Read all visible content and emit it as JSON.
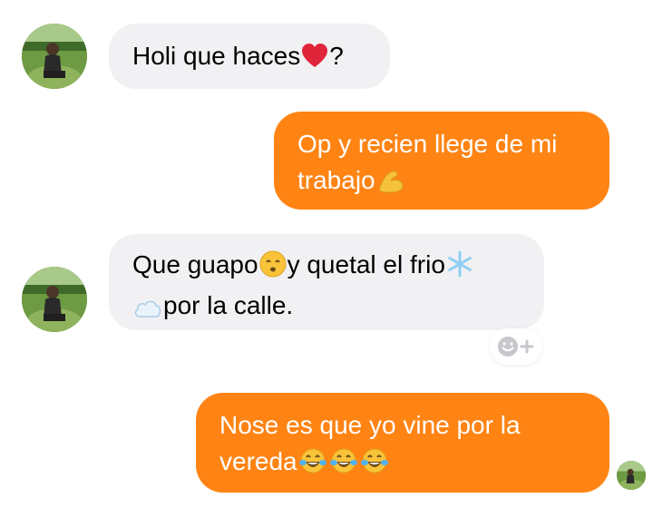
{
  "conversation": {
    "messages": [
      {
        "direction": "incoming",
        "lines": [
          [
            "Holi que haces",
            "heart-emoji",
            "?"
          ]
        ]
      },
      {
        "direction": "outgoing",
        "lines": [
          [
            "Op y recien llege de mi"
          ],
          [
            "trabajo",
            "flexed-biceps-emoji"
          ]
        ]
      },
      {
        "direction": "incoming",
        "lines": [
          [
            "Que guapo",
            "kissing-emoji",
            "y quetal el frio",
            "snowflake-emoji"
          ],
          [
            "cloud-emoji",
            "por la calle."
          ]
        ]
      },
      {
        "direction": "outgoing",
        "lines": [
          [
            "Nose es que yo vine por la"
          ],
          [
            "vereda",
            "tears-of-joy-emoji",
            "tears-of-joy-emoji",
            "tears-of-joy-emoji"
          ]
        ]
      }
    ],
    "m1": {
      "text1": "Holi que haces",
      "text2": "?"
    },
    "m2": {
      "line1": "Op y recien llege de mi",
      "line2": "trabajo"
    },
    "m3": {
      "line1a": "Que guapo",
      "line1b": "y quetal el frio",
      "line2": "por la calle."
    },
    "m4": {
      "line1": "Nose es que yo vine por la",
      "line2": "vereda"
    },
    "reaction_button": {
      "icon": "smiley-add-icon",
      "label": "+"
    },
    "colors": {
      "incoming_bubble": "#f1f0f3",
      "outgoing_bubble": "#ff8414",
      "incoming_text": "#000000",
      "outgoing_text": "#ffffff"
    }
  }
}
